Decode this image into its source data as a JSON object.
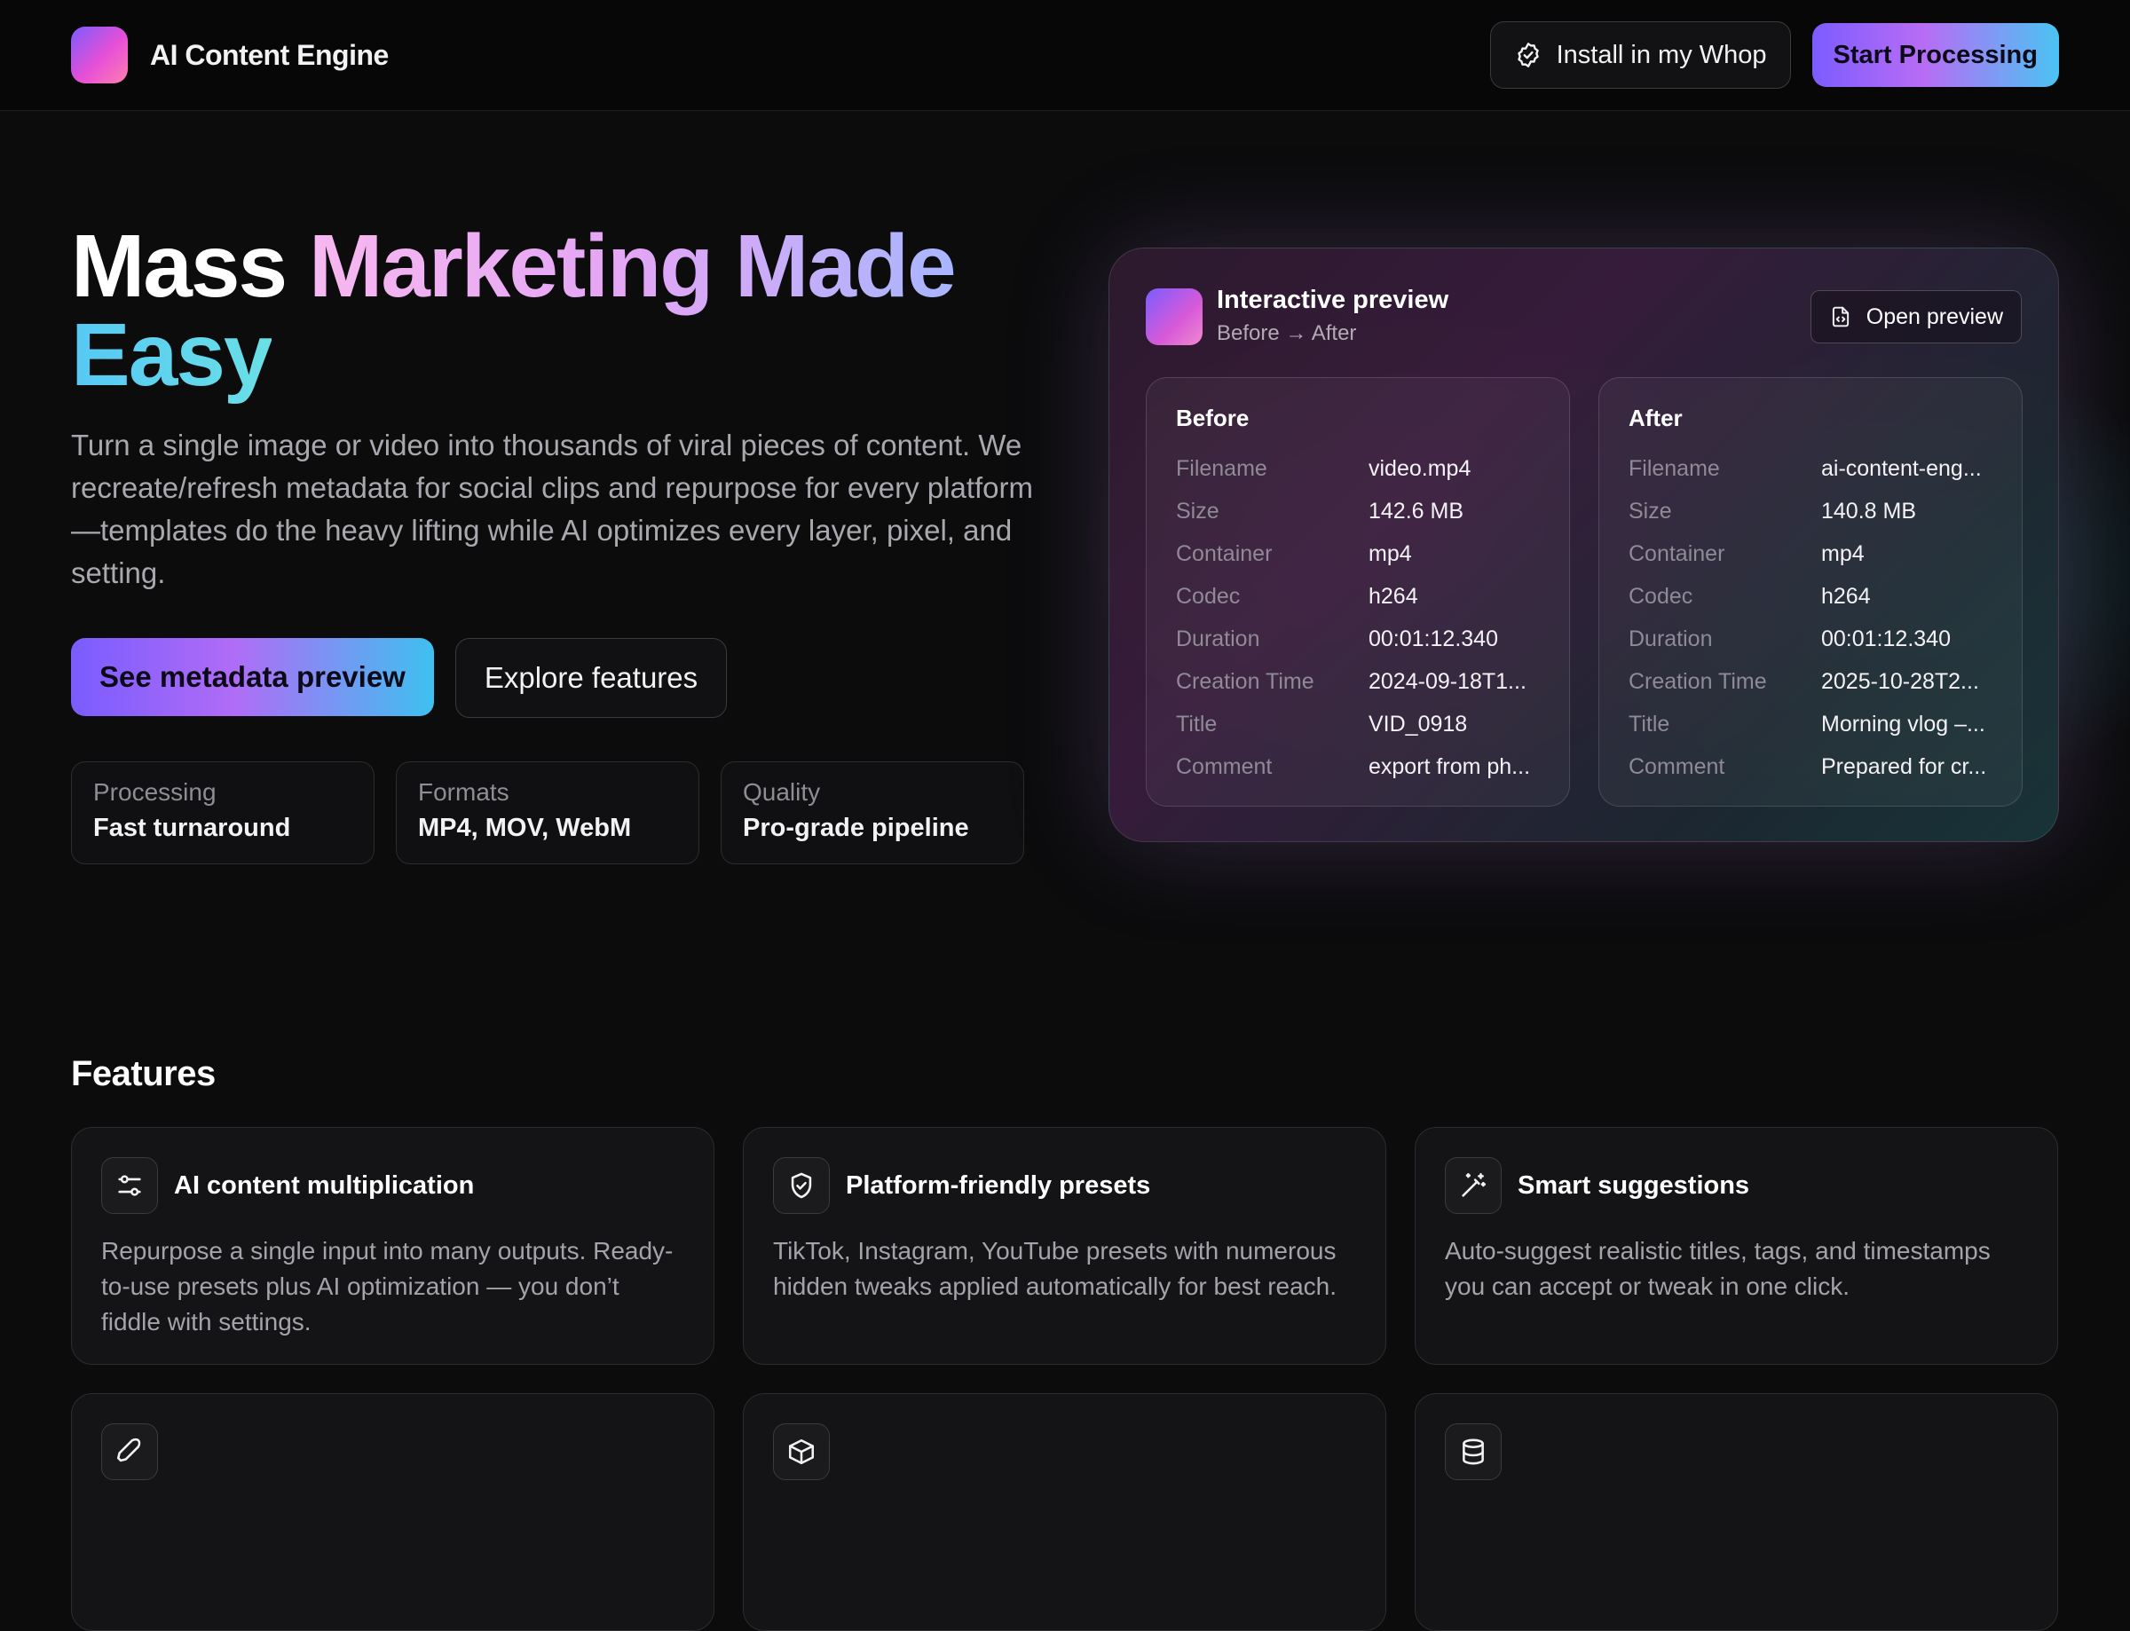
{
  "header": {
    "brand": "AI Content Engine",
    "install_label": "Install in my Whop",
    "start_label": "Start Processing"
  },
  "hero": {
    "title_part1": "Mass ",
    "title_part2": "Marketing Made",
    "title_part3": "Easy",
    "subtitle": "Turn a single image or video into thousands of viral pieces of content. We recreate/refresh metadata for social clips and repurpose for every platform—templates do the heavy lifting while AI optimizes every layer, pixel, and setting.",
    "primary_cta": "See metadata preview",
    "secondary_cta": "Explore features",
    "stats": [
      {
        "label": "Processing",
        "value": "Fast turnaround"
      },
      {
        "label": "Formats",
        "value": "MP4, MOV, WebM"
      },
      {
        "label": "Quality",
        "value": "Pro-grade pipeline"
      }
    ]
  },
  "preview": {
    "title": "Interactive preview",
    "subtitle": "Before → After",
    "open_label": "Open preview",
    "before": {
      "heading": "Before",
      "rows": [
        {
          "k": "Filename",
          "v": "video.mp4"
        },
        {
          "k": "Size",
          "v": "142.6 MB"
        },
        {
          "k": "Container",
          "v": "mp4"
        },
        {
          "k": "Codec",
          "v": "h264"
        },
        {
          "k": "Duration",
          "v": "00:01:12.340"
        },
        {
          "k": "Creation Time",
          "v": "2024-09-18T1..."
        },
        {
          "k": "Title",
          "v": "VID_0918"
        },
        {
          "k": "Comment",
          "v": "export from ph..."
        }
      ]
    },
    "after": {
      "heading": "After",
      "rows": [
        {
          "k": "Filename",
          "v": "ai-content-eng..."
        },
        {
          "k": "Size",
          "v": "140.8 MB"
        },
        {
          "k": "Container",
          "v": "mp4"
        },
        {
          "k": "Codec",
          "v": "h264"
        },
        {
          "k": "Duration",
          "v": "00:01:12.340"
        },
        {
          "k": "Creation Time",
          "v": "2025-10-28T2..."
        },
        {
          "k": "Title",
          "v": "Morning vlog –..."
        },
        {
          "k": "Comment",
          "v": "Prepared for cr..."
        }
      ]
    }
  },
  "features": {
    "title": "Features",
    "items": [
      {
        "icon": "sliders-icon",
        "name": "AI content multiplication",
        "desc": "Repurpose a single input into many outputs. Ready-to-use presets plus AI optimization — you don’t fiddle with settings."
      },
      {
        "icon": "shield-check-icon",
        "name": "Platform-friendly presets",
        "desc": "TikTok, Instagram, YouTube presets with numerous hidden tweaks applied automatically for best reach."
      },
      {
        "icon": "magic-wand-icon",
        "name": "Smart suggestions",
        "desc": "Auto-suggest realistic titles, tags, and timestamps you can accept or tweak in one click."
      },
      {
        "icon": "rocket-icon",
        "name": "",
        "desc": ""
      },
      {
        "icon": "box-icon",
        "name": "",
        "desc": ""
      },
      {
        "icon": "database-icon",
        "name": "",
        "desc": ""
      }
    ]
  },
  "colors": {
    "background": "#0c0c0d",
    "accent_gradient_start": "#7c5cff",
    "accent_gradient_end": "#4ac4f2"
  }
}
